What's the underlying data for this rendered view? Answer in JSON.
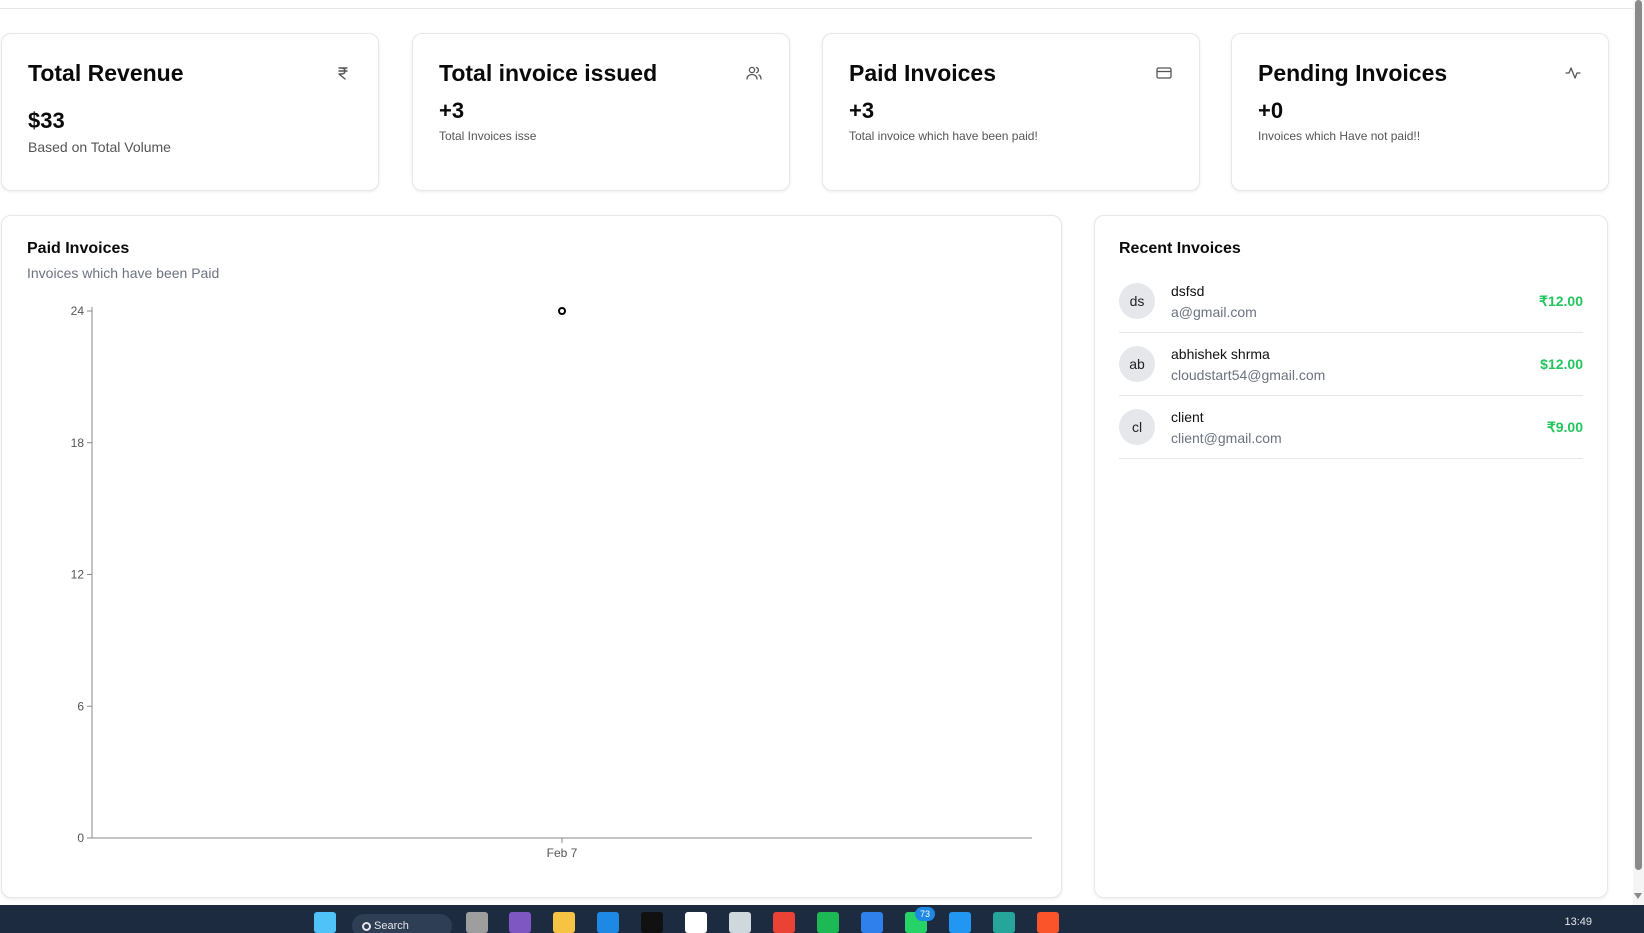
{
  "stats": [
    {
      "title": "Total Revenue",
      "value": "$33",
      "desc": "Based on Total Volume",
      "icon": "rupee-icon"
    },
    {
      "title": "Total invoice issued",
      "value": "+3",
      "desc": "Total Invoices isse",
      "icon": "users-icon"
    },
    {
      "title": "Paid Invoices",
      "value": "+3",
      "desc": "Total invoice which have been paid!",
      "icon": "credit-card-icon"
    },
    {
      "title": "Pending Invoices",
      "value": "+0",
      "desc": "Invoices which Have not paid!!",
      "icon": "activity-icon"
    }
  ],
  "chart_card": {
    "title": "Paid Invoices",
    "subtitle": "Invoices which have been Paid"
  },
  "chart_data": {
    "type": "line",
    "categories": [
      "Feb 7"
    ],
    "series": [
      {
        "values": [
          24
        ]
      }
    ],
    "ylim": [
      0,
      24
    ],
    "yticks": [
      0,
      6,
      12,
      18,
      24
    ],
    "grid": false
  },
  "recent": {
    "title": "Recent Invoices",
    "items": [
      {
        "initials": "ds",
        "name": "dsfsd",
        "email": "a@gmail.com",
        "amount": "₹12.00"
      },
      {
        "initials": "ab",
        "name": "abhishek shrma",
        "email": "cloudstart54@gmail.com",
        "amount": "$12.00"
      },
      {
        "initials": "cl",
        "name": "client",
        "email": "client@gmail.com",
        "amount": "₹9.00"
      }
    ]
  },
  "taskbar": {
    "search_label": "Search",
    "clock": "13:49",
    "notification_count": "73"
  },
  "colors": {
    "amount": "#22c55e",
    "taskbar": "#1c2b3f"
  }
}
